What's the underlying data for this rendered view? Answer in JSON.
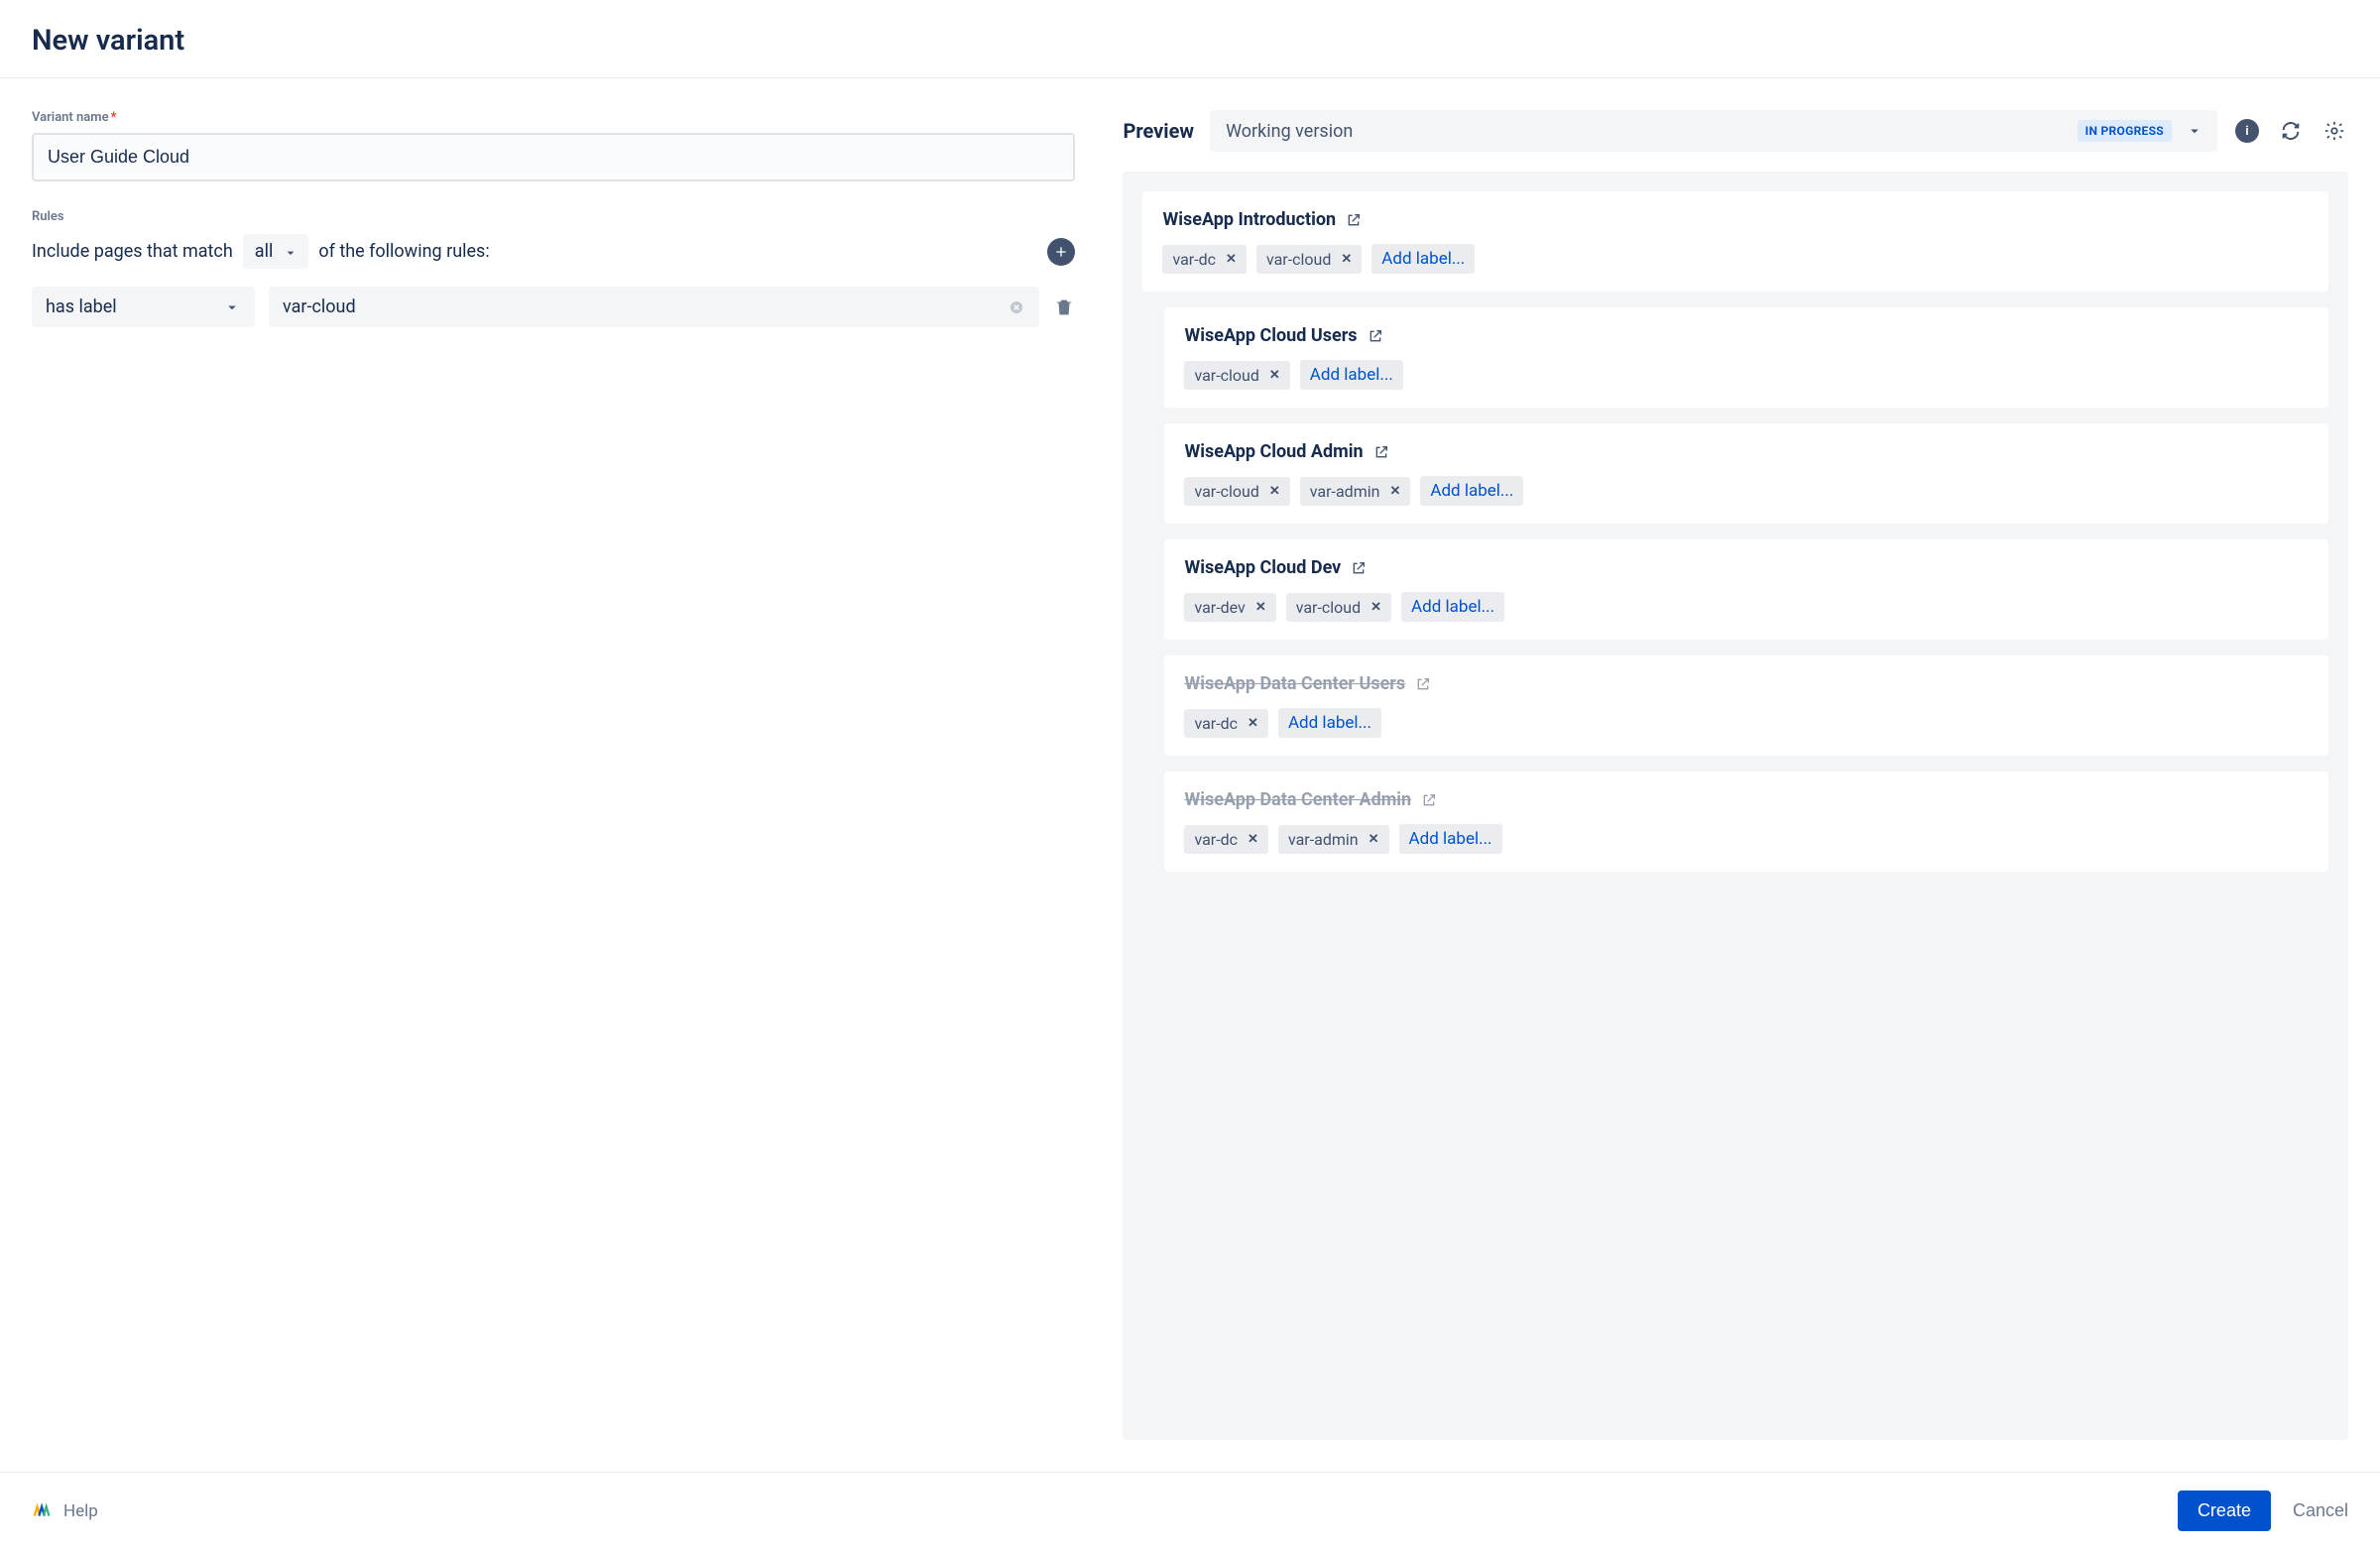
{
  "header": {
    "title": "New variant"
  },
  "form": {
    "name_label": "Variant name",
    "name_value": "User Guide Cloud",
    "rules_label": "Rules",
    "rule_prefix": "Include pages that match",
    "rule_match_mode": "all",
    "rule_suffix": "of the following rules:",
    "rule_condition": "has label",
    "rule_value": "var-cloud"
  },
  "preview": {
    "title": "Preview",
    "version": "Working version",
    "status": "IN PROGRESS",
    "add_label_text": "Add label...",
    "pages": [
      {
        "title": "WiseApp Introduction",
        "indent": false,
        "excluded": false,
        "labels": [
          "var-dc",
          "var-cloud"
        ]
      },
      {
        "title": "WiseApp Cloud Users",
        "indent": true,
        "excluded": false,
        "labels": [
          "var-cloud"
        ]
      },
      {
        "title": "WiseApp Cloud Admin",
        "indent": true,
        "excluded": false,
        "labels": [
          "var-cloud",
          "var-admin"
        ]
      },
      {
        "title": "WiseApp Cloud Dev",
        "indent": true,
        "excluded": false,
        "labels": [
          "var-dev",
          "var-cloud"
        ]
      },
      {
        "title": "WiseApp Data Center Users",
        "indent": true,
        "excluded": true,
        "labels": [
          "var-dc"
        ]
      },
      {
        "title": "WiseApp Data Center Admin",
        "indent": true,
        "excluded": true,
        "labels": [
          "var-dc",
          "var-admin"
        ]
      }
    ]
  },
  "footer": {
    "help": "Help",
    "create": "Create",
    "cancel": "Cancel"
  }
}
